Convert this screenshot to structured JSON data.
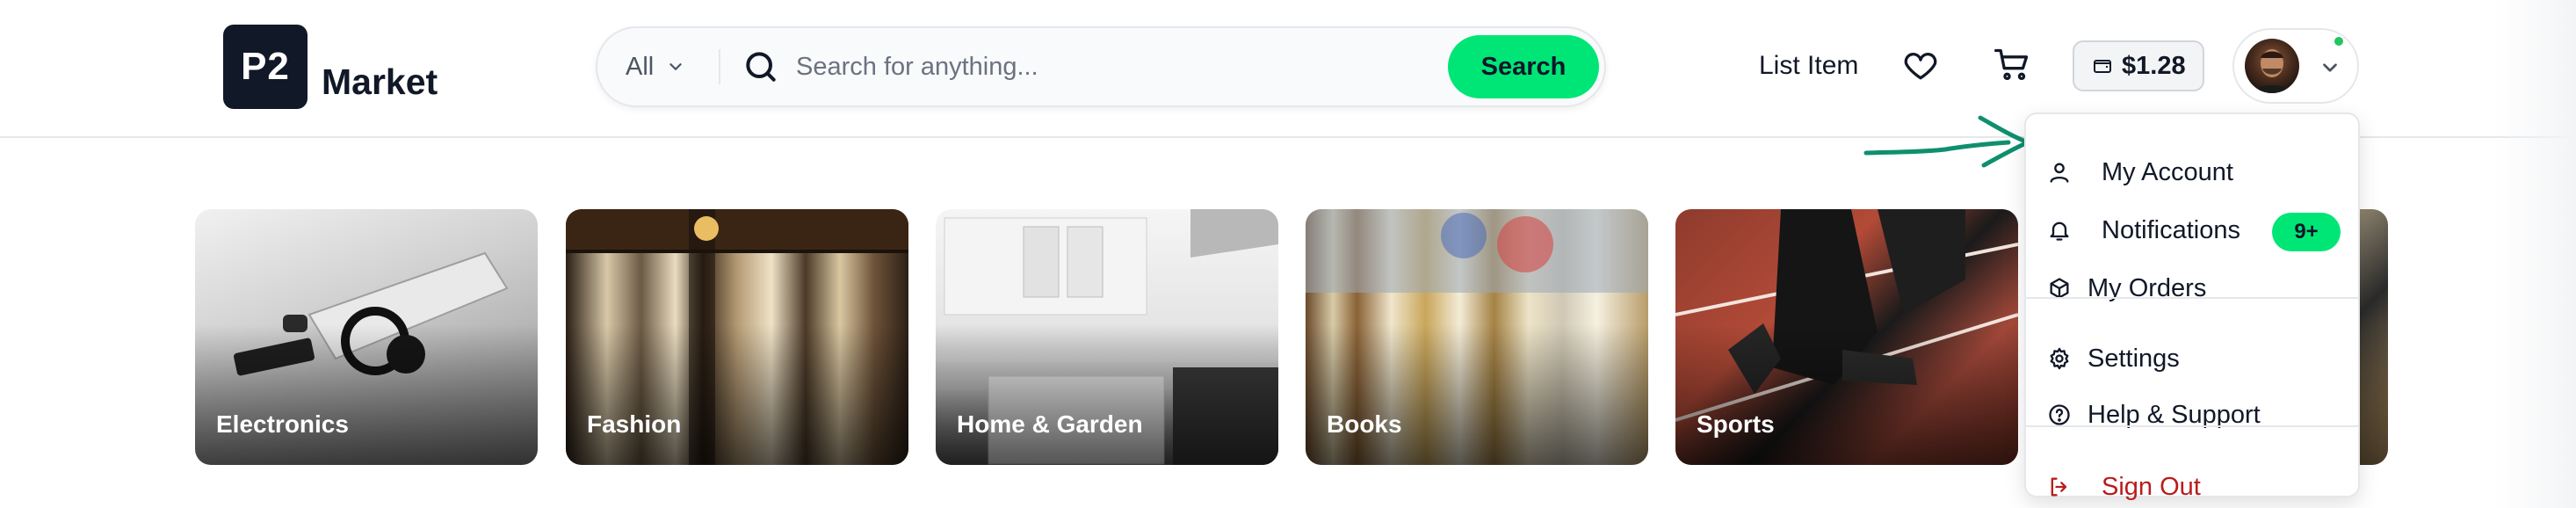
{
  "header": {
    "logo": {
      "mark": "P2",
      "name": "Market"
    },
    "search": {
      "category": "All",
      "placeholder": "Search for anything...",
      "value": "",
      "button_label": "Search"
    },
    "nav": {
      "list_item_label": "List Item",
      "wallet_balance": "$1.28"
    },
    "profile": {
      "status_color": "#22c55e"
    }
  },
  "dropdown": {
    "items": [
      {
        "label": "My Account",
        "icon": "user-icon"
      },
      {
        "label": "Notifications",
        "icon": "bell-icon",
        "badge": "9+"
      },
      {
        "label": "My Orders",
        "icon": "package-icon"
      },
      {
        "label": "Settings",
        "icon": "gear-icon"
      },
      {
        "label": "Help & Support",
        "icon": "help-circle-icon"
      },
      {
        "label": "Sign Out",
        "icon": "sign-out-icon"
      }
    ]
  },
  "categories": [
    {
      "label": "Electronics"
    },
    {
      "label": "Fashion"
    },
    {
      "label": "Home & Garden"
    },
    {
      "label": "Books"
    },
    {
      "label": "Sports"
    },
    {
      "label": ""
    }
  ],
  "colors": {
    "accent": "#00e676",
    "logo_bg": "#111827",
    "danger": "#b91c1c",
    "annotation_arrow": "#0f8f6e"
  }
}
